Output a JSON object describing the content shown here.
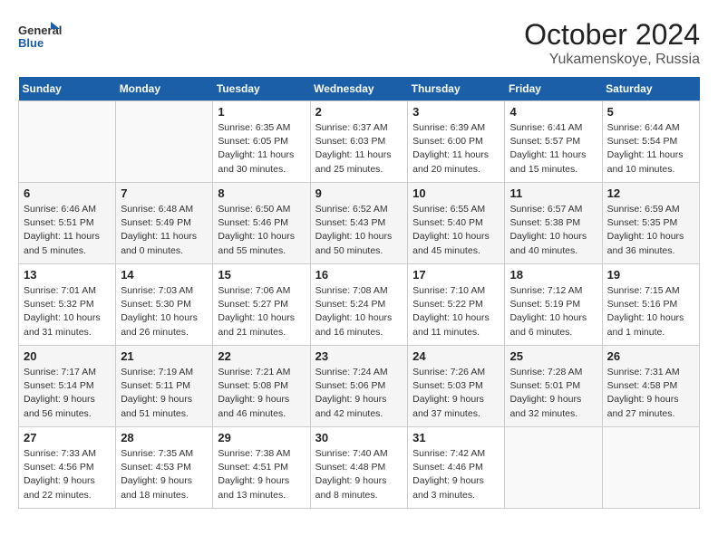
{
  "header": {
    "logo_general": "General",
    "logo_blue": "Blue",
    "month_year": "October 2024",
    "location": "Yukamenskoye, Russia"
  },
  "weekdays": [
    "Sunday",
    "Monday",
    "Tuesday",
    "Wednesday",
    "Thursday",
    "Friday",
    "Saturday"
  ],
  "weeks": [
    [
      {
        "day": "",
        "info": ""
      },
      {
        "day": "",
        "info": ""
      },
      {
        "day": "1",
        "info": "Sunrise: 6:35 AM\nSunset: 6:05 PM\nDaylight: 11 hours and 30 minutes."
      },
      {
        "day": "2",
        "info": "Sunrise: 6:37 AM\nSunset: 6:03 PM\nDaylight: 11 hours and 25 minutes."
      },
      {
        "day": "3",
        "info": "Sunrise: 6:39 AM\nSunset: 6:00 PM\nDaylight: 11 hours and 20 minutes."
      },
      {
        "day": "4",
        "info": "Sunrise: 6:41 AM\nSunset: 5:57 PM\nDaylight: 11 hours and 15 minutes."
      },
      {
        "day": "5",
        "info": "Sunrise: 6:44 AM\nSunset: 5:54 PM\nDaylight: 11 hours and 10 minutes."
      }
    ],
    [
      {
        "day": "6",
        "info": "Sunrise: 6:46 AM\nSunset: 5:51 PM\nDaylight: 11 hours and 5 minutes."
      },
      {
        "day": "7",
        "info": "Sunrise: 6:48 AM\nSunset: 5:49 PM\nDaylight: 11 hours and 0 minutes."
      },
      {
        "day": "8",
        "info": "Sunrise: 6:50 AM\nSunset: 5:46 PM\nDaylight: 10 hours and 55 minutes."
      },
      {
        "day": "9",
        "info": "Sunrise: 6:52 AM\nSunset: 5:43 PM\nDaylight: 10 hours and 50 minutes."
      },
      {
        "day": "10",
        "info": "Sunrise: 6:55 AM\nSunset: 5:40 PM\nDaylight: 10 hours and 45 minutes."
      },
      {
        "day": "11",
        "info": "Sunrise: 6:57 AM\nSunset: 5:38 PM\nDaylight: 10 hours and 40 minutes."
      },
      {
        "day": "12",
        "info": "Sunrise: 6:59 AM\nSunset: 5:35 PM\nDaylight: 10 hours and 36 minutes."
      }
    ],
    [
      {
        "day": "13",
        "info": "Sunrise: 7:01 AM\nSunset: 5:32 PM\nDaylight: 10 hours and 31 minutes."
      },
      {
        "day": "14",
        "info": "Sunrise: 7:03 AM\nSunset: 5:30 PM\nDaylight: 10 hours and 26 minutes."
      },
      {
        "day": "15",
        "info": "Sunrise: 7:06 AM\nSunset: 5:27 PM\nDaylight: 10 hours and 21 minutes."
      },
      {
        "day": "16",
        "info": "Sunrise: 7:08 AM\nSunset: 5:24 PM\nDaylight: 10 hours and 16 minutes."
      },
      {
        "day": "17",
        "info": "Sunrise: 7:10 AM\nSunset: 5:22 PM\nDaylight: 10 hours and 11 minutes."
      },
      {
        "day": "18",
        "info": "Sunrise: 7:12 AM\nSunset: 5:19 PM\nDaylight: 10 hours and 6 minutes."
      },
      {
        "day": "19",
        "info": "Sunrise: 7:15 AM\nSunset: 5:16 PM\nDaylight: 10 hours and 1 minute."
      }
    ],
    [
      {
        "day": "20",
        "info": "Sunrise: 7:17 AM\nSunset: 5:14 PM\nDaylight: 9 hours and 56 minutes."
      },
      {
        "day": "21",
        "info": "Sunrise: 7:19 AM\nSunset: 5:11 PM\nDaylight: 9 hours and 51 minutes."
      },
      {
        "day": "22",
        "info": "Sunrise: 7:21 AM\nSunset: 5:08 PM\nDaylight: 9 hours and 46 minutes."
      },
      {
        "day": "23",
        "info": "Sunrise: 7:24 AM\nSunset: 5:06 PM\nDaylight: 9 hours and 42 minutes."
      },
      {
        "day": "24",
        "info": "Sunrise: 7:26 AM\nSunset: 5:03 PM\nDaylight: 9 hours and 37 minutes."
      },
      {
        "day": "25",
        "info": "Sunrise: 7:28 AM\nSunset: 5:01 PM\nDaylight: 9 hours and 32 minutes."
      },
      {
        "day": "26",
        "info": "Sunrise: 7:31 AM\nSunset: 4:58 PM\nDaylight: 9 hours and 27 minutes."
      }
    ],
    [
      {
        "day": "27",
        "info": "Sunrise: 7:33 AM\nSunset: 4:56 PM\nDaylight: 9 hours and 22 minutes."
      },
      {
        "day": "28",
        "info": "Sunrise: 7:35 AM\nSunset: 4:53 PM\nDaylight: 9 hours and 18 minutes."
      },
      {
        "day": "29",
        "info": "Sunrise: 7:38 AM\nSunset: 4:51 PM\nDaylight: 9 hours and 13 minutes."
      },
      {
        "day": "30",
        "info": "Sunrise: 7:40 AM\nSunset: 4:48 PM\nDaylight: 9 hours and 8 minutes."
      },
      {
        "day": "31",
        "info": "Sunrise: 7:42 AM\nSunset: 4:46 PM\nDaylight: 9 hours and 3 minutes."
      },
      {
        "day": "",
        "info": ""
      },
      {
        "day": "",
        "info": ""
      }
    ]
  ]
}
